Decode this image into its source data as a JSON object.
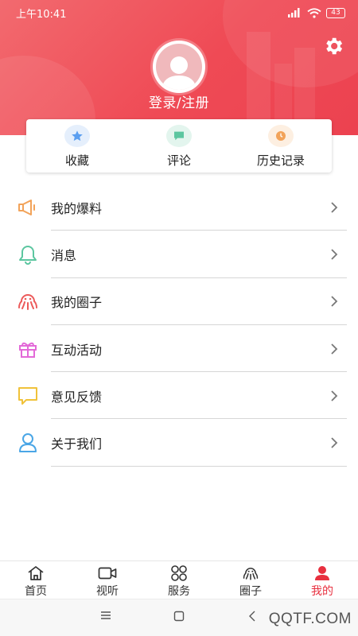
{
  "status_bar": {
    "time": "上午10:41",
    "battery": "43"
  },
  "header": {
    "login_label": "登录/注册"
  },
  "quick_actions": [
    {
      "label": "收藏",
      "icon": "star-icon",
      "color": "#5b9ff0",
      "bg": "#e5effc"
    },
    {
      "label": "评论",
      "icon": "comment-icon",
      "color": "#5cc6a0",
      "bg": "#e3f5ee"
    },
    {
      "label": "历史记录",
      "icon": "clock-icon",
      "color": "#f2a35a",
      "bg": "#fdefe1"
    }
  ],
  "menu": [
    {
      "label": "我的爆料",
      "icon": "megaphone-icon",
      "color": "#f2a35a"
    },
    {
      "label": "消息",
      "icon": "bell-icon",
      "color": "#5cc6a0"
    },
    {
      "label": "我的圈子",
      "icon": "octopus-icon",
      "color": "#ec5a5a"
    },
    {
      "label": "互动活动",
      "icon": "gift-icon",
      "color": "#e36ad8"
    },
    {
      "label": "意见反馈",
      "icon": "feedback-icon",
      "color": "#f0c23a"
    },
    {
      "label": "关于我们",
      "icon": "user-icon",
      "color": "#4aa6e6"
    }
  ],
  "tabs": [
    {
      "label": "首页",
      "icon": "home-icon",
      "active": false
    },
    {
      "label": "视听",
      "icon": "video-icon",
      "active": false
    },
    {
      "label": "服务",
      "icon": "grid-icon",
      "active": false
    },
    {
      "label": "圈子",
      "icon": "octopus-icon",
      "active": false
    },
    {
      "label": "我的",
      "icon": "person-icon",
      "active": true
    }
  ],
  "colors": {
    "accent": "#e8303f",
    "header": "#ef4a55"
  },
  "watermark": "QQTF.COM"
}
